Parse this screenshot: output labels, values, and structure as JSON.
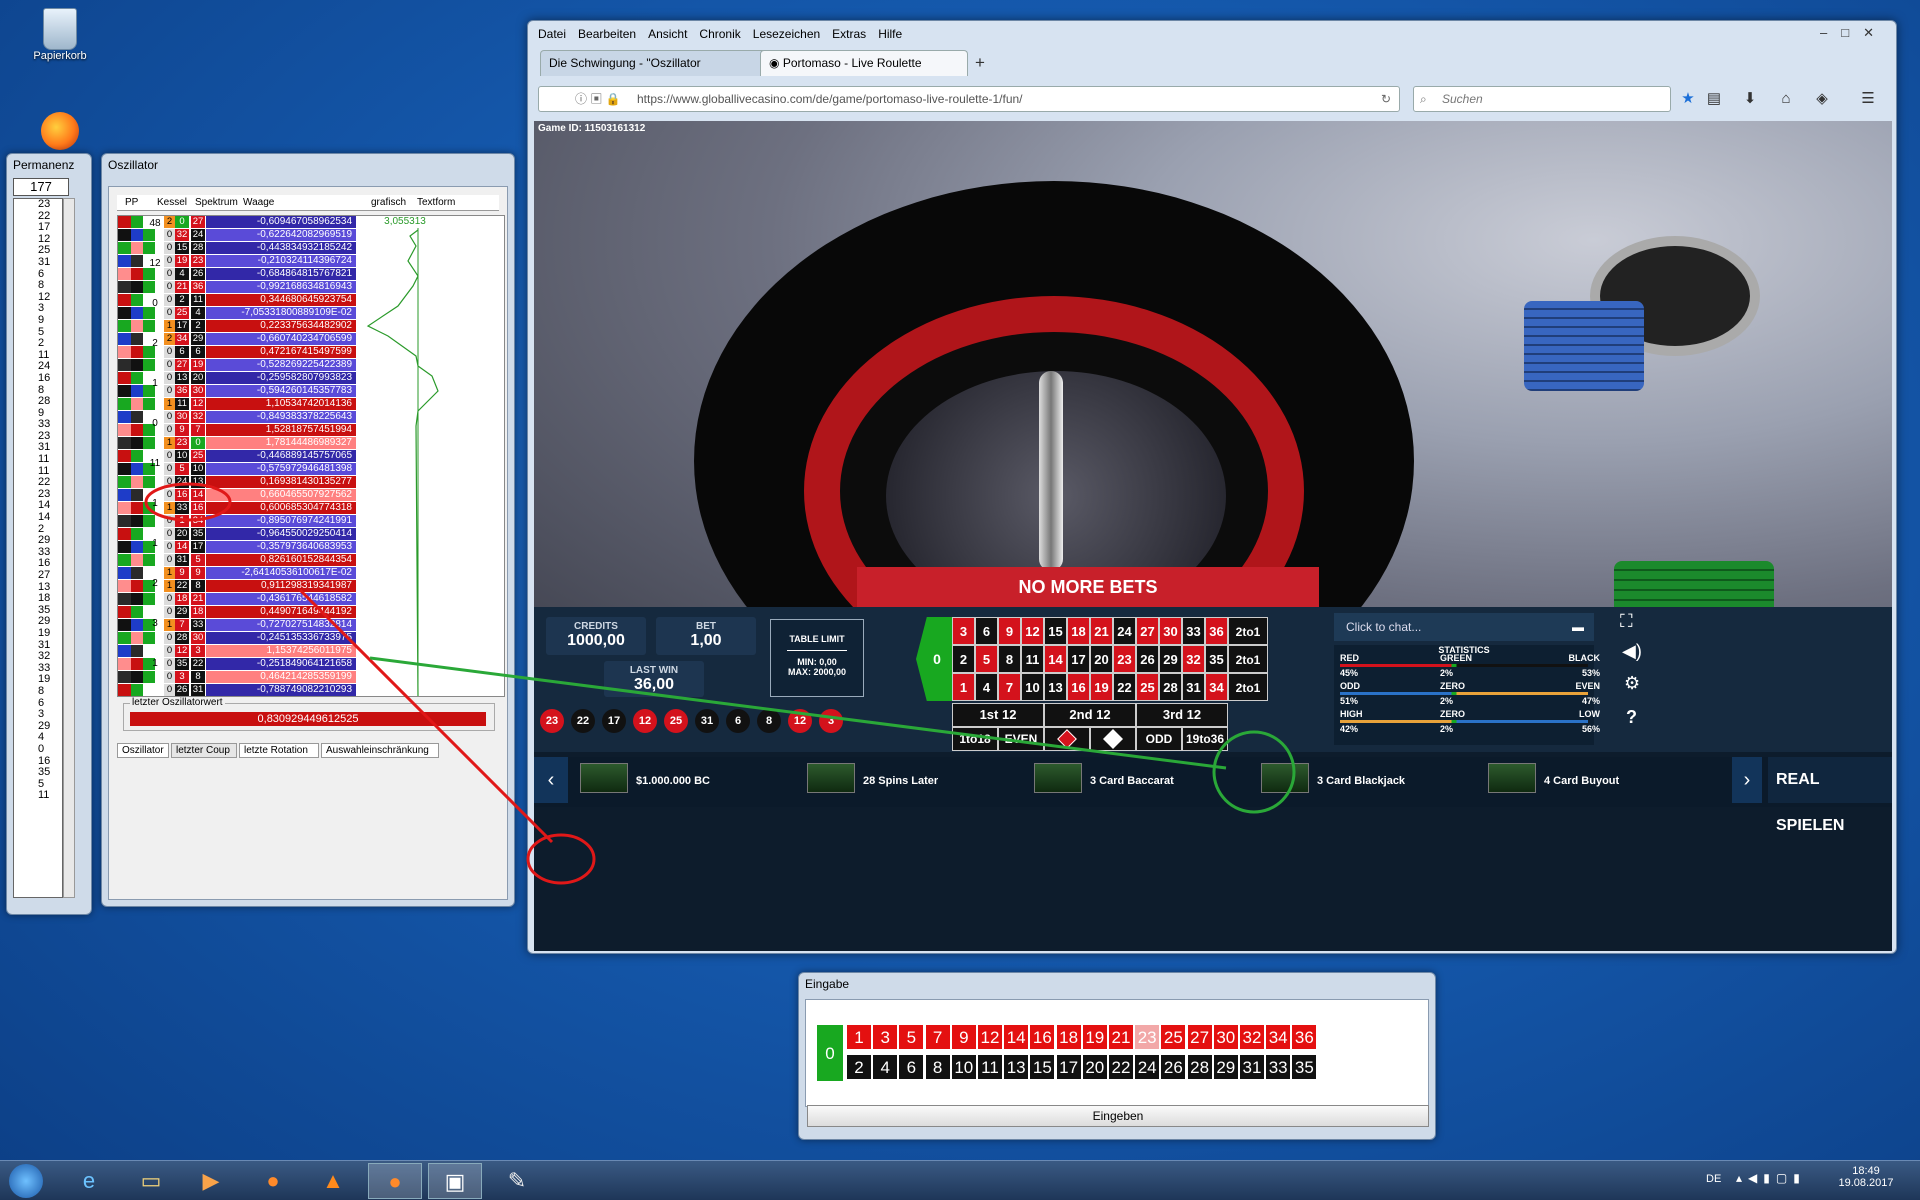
{
  "desktop": {
    "recycle_bin": "Papierkorb"
  },
  "permanenz": {
    "title": "Permanenz",
    "count": "177",
    "numbers": [
      "23",
      "22",
      "17",
      "12",
      "25",
      "31",
      "6",
      "8",
      "12",
      "3",
      "9",
      "5",
      "2",
      "11",
      "24",
      "16",
      "8",
      "28",
      "9",
      "33",
      "23",
      "31",
      "11",
      "11",
      "22",
      "23",
      "14",
      "14",
      "2",
      "29",
      "33",
      "16",
      "27",
      "13",
      "18",
      "35",
      "29",
      "19",
      "31",
      "32",
      "33",
      "19",
      "8",
      "6",
      "3",
      "29",
      "4",
      "0",
      "16",
      "35",
      "5",
      "11"
    ]
  },
  "oszillator": {
    "title": "Oszillator",
    "headers": {
      "pp": "PP",
      "kessel": "Kessel",
      "spektrum": "Spektrum",
      "waage": "Waage",
      "grafisch": "grafisch",
      "textform": "Textform"
    },
    "graph_max": "3,055313",
    "kessel_marks": [
      "48",
      "12",
      "0",
      "2",
      "1",
      "0",
      "11",
      "1",
      "1",
      "2",
      "3",
      "1"
    ],
    "rows": [
      {
        "a": "2",
        "an": "0",
        "b": "27",
        "v": "-0,609467058962534"
      },
      {
        "a": "0",
        "an": "32",
        "b": "24",
        "v": "-0,622642082969519"
      },
      {
        "a": "0",
        "an": "15",
        "b": "28",
        "v": "-0,443834932185242"
      },
      {
        "a": "0",
        "an": "19",
        "b": "23",
        "v": "-0,210324114396724"
      },
      {
        "a": "0",
        "an": "4",
        "b": "26",
        "v": "-0,684864815767821"
      },
      {
        "a": "0",
        "an": "21",
        "b": "36",
        "v": "-0,992168634816943"
      },
      {
        "a": "0",
        "an": "2",
        "b": "11",
        "v": "0,344680645923754"
      },
      {
        "a": "0",
        "an": "25",
        "b": "4",
        "v": "-7,05331800889109E-02"
      },
      {
        "a": "1",
        "an": "17",
        "b": "2",
        "v": "0,223375634482902"
      },
      {
        "a": "2",
        "an": "34",
        "b": "29",
        "v": "-0,660740234706599"
      },
      {
        "a": "0",
        "an": "6",
        "b": "6",
        "v": "0,472167415497599"
      },
      {
        "a": "0",
        "an": "27",
        "b": "19",
        "v": "-0,528269225422389"
      },
      {
        "a": "0",
        "an": "13",
        "b": "20",
        "v": "-0,259582807993823"
      },
      {
        "a": "0",
        "an": "36",
        "b": "30",
        "v": "-0,594260145357783"
      },
      {
        "a": "1",
        "an": "11",
        "b": "12",
        "v": "1,10534742014136"
      },
      {
        "a": "0",
        "an": "30",
        "b": "32",
        "v": "-0,849383378225643"
      },
      {
        "a": "0",
        "an": "9",
        "b": "7",
        "v": "1,52818757451994"
      },
      {
        "a": "1",
        "an": "23",
        "b": "0",
        "v": "1,78144486989327"
      },
      {
        "a": "0",
        "an": "10",
        "b": "25",
        "v": "-0,446889145757065"
      },
      {
        "a": "0",
        "an": "5",
        "b": "10",
        "v": "-0,575972946481398"
      },
      {
        "a": "0",
        "an": "24",
        "b": "13",
        "v": "0,169381430135277"
      },
      {
        "a": "0",
        "an": "16",
        "b": "14",
        "v": "0,660465507927562"
      },
      {
        "a": "1",
        "an": "33",
        "b": "16",
        "v": "0,600685304774318"
      },
      {
        "a": "0",
        "an": "1",
        "b": "34",
        "v": "-0,895076974241991"
      },
      {
        "a": "0",
        "an": "20",
        "b": "35",
        "v": "-0,964550029250414"
      },
      {
        "a": "0",
        "an": "14",
        "b": "17",
        "v": "-0,357973640683953"
      },
      {
        "a": "0",
        "an": "31",
        "b": "5",
        "v": "0,826160152844354"
      },
      {
        "a": "1",
        "an": "9",
        "b": "9",
        "v": "-2,64140536100617E-02"
      },
      {
        "a": "1",
        "an": "22",
        "b": "8",
        "v": "0,911298319341987"
      },
      {
        "a": "0",
        "an": "18",
        "b": "21",
        "v": "-0,436176544618582"
      },
      {
        "a": "0",
        "an": "29",
        "b": "18",
        "v": "0,449071649444192"
      },
      {
        "a": "1",
        "an": "7",
        "b": "33",
        "v": "-0,727027514832814"
      },
      {
        "a": "0",
        "an": "28",
        "b": "30",
        "v": "-0,245135336733975"
      },
      {
        "a": "0",
        "an": "12",
        "b": "3",
        "v": "1,15374256011975"
      },
      {
        "a": "0",
        "an": "35",
        "b": "22",
        "v": "-0,251849064121658"
      },
      {
        "a": "0",
        "an": "3",
        "b": "8",
        "v": "0,464214285359199"
      },
      {
        "a": "0",
        "an": "26",
        "b": "31",
        "v": "-0,788749082210293"
      }
    ],
    "last_value_label": "letzter Oszillatorwert",
    "last_value": "0,830929449612525",
    "tabs": [
      "Oszillator",
      "letzter Coup",
      "letzte Rotation",
      "Auswahleinschränkung"
    ]
  },
  "firefox": {
    "menu": [
      "Datei",
      "Bearbeiten",
      "Ansicht",
      "Chronik",
      "Lesezeichen",
      "Extras",
      "Hilfe"
    ],
    "tabs": [
      {
        "label": "Die Schwingung - \"Oszillator"
      },
      {
        "label": "Portomaso - Live Roulette"
      }
    ],
    "url": "https://www.globallivecasino.com/de/game/portomaso-live-roulette-1/fun/",
    "search_placeholder": "Suchen"
  },
  "game": {
    "game_id": "Game ID: 11503161312",
    "no_more_bets": "NO MORE BETS",
    "credits_label": "CREDITS",
    "credits": "1000,00",
    "bet_label": "BET",
    "bet": "1,00",
    "last_win_label": "LAST WIN",
    "last_win": "36,00",
    "table_limit_label": "TABLE LIMIT",
    "min": "MIN: 0,00",
    "max": "MAX: 2000,00",
    "history": [
      "23",
      "22",
      "17",
      "12",
      "25",
      "31",
      "6",
      "8",
      "12",
      "3"
    ],
    "dozens": [
      "1st 12",
      "2nd 12",
      "3rd 12"
    ],
    "outside": [
      "1to18",
      "EVEN",
      "",
      "",
      "ODD",
      "19to36"
    ],
    "columns": "2to1",
    "chat_placeholder": "Click to chat...",
    "stats": {
      "title": "STATISTICS",
      "rows": [
        {
          "l": "RED",
          "m": "GREEN",
          "r": "BLACK",
          "lv": "45%",
          "mv": "2%",
          "rv": "53%"
        },
        {
          "l": "ODD",
          "m": "ZERO",
          "r": "EVEN",
          "lv": "51%",
          "mv": "2%",
          "rv": "47%"
        },
        {
          "l": "HIGH",
          "m": "ZERO",
          "r": "LOW",
          "lv": "42%",
          "mv": "2%",
          "rv": "56%"
        }
      ]
    },
    "promos": [
      "$1.000.000 BC",
      "28 Spins Later",
      "3 Card Baccarat",
      "3 Card Blackjack",
      "4 Card Buyout"
    ],
    "real_play": "REAL SPIELEN"
  },
  "eingabe": {
    "title": "Eingabe",
    "button": "Eingeben",
    "top": [
      "1",
      "3",
      "5",
      "7",
      "9",
      "12",
      "14",
      "16",
      "18",
      "19",
      "21",
      "23",
      "25",
      "27",
      "30",
      "32",
      "34",
      "36"
    ],
    "bottom": [
      "2",
      "4",
      "6",
      "8",
      "10",
      "11",
      "13",
      "15",
      "17",
      "20",
      "22",
      "24",
      "26",
      "28",
      "29",
      "31",
      "33",
      "35"
    ]
  },
  "taskbar": {
    "lang": "DE",
    "time": "18:49",
    "date": "19.08.2017"
  }
}
